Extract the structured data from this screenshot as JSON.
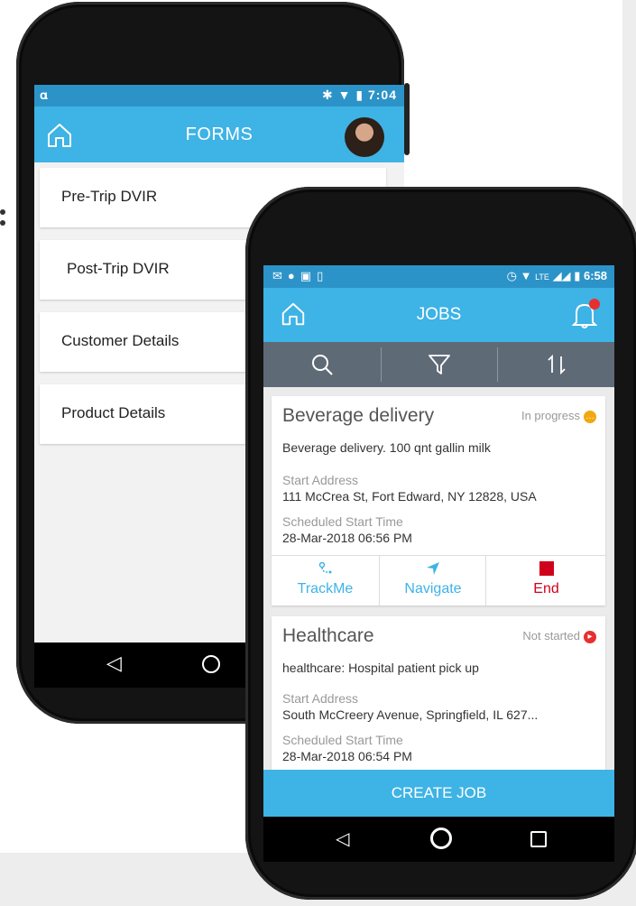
{
  "colors": {
    "appbar": "#3eb3e5",
    "statusbar": "#2c93c8",
    "toolbar": "#5e6a76",
    "in_progress": "#f2a812",
    "not_started": "#e63030",
    "end": "#d0021b"
  },
  "forms_screen": {
    "status_time": "7:04",
    "title": "FORMS",
    "items": [
      {
        "label": "Pre-Trip DVIR"
      },
      {
        "label": "Post-Trip DVIR"
      },
      {
        "label": "Customer Details"
      },
      {
        "label": "Product Details"
      }
    ]
  },
  "jobs_screen": {
    "status_time": "6:58",
    "status_network": "LTE",
    "title": "JOBS",
    "toolbar": {
      "search_icon": "search-icon",
      "filter_icon": "filter-icon",
      "sort_icon": "sort-icon"
    },
    "jobs": [
      {
        "title": "Beverage delivery",
        "status": "In progress",
        "description": "Beverage delivery. 100 qnt gallin milk",
        "address_label": "Start Address",
        "address": "111 McCrea St, Fort Edward, NY 12828, USA",
        "time_label": "Scheduled Start Time",
        "time": "28-Mar-2018 06:56 PM",
        "actions": {
          "trackme": "TrackMe",
          "navigate": "Navigate",
          "end": "End"
        }
      },
      {
        "title": "Healthcare",
        "status": "Not started",
        "description": "healthcare: Hospital patient pick up",
        "address_label": "Start Address",
        "address": "South McCreery Avenue, Springfield, IL 627...",
        "time_label": "Scheduled Start Time",
        "time": "28-Mar-2018 06:54 PM"
      }
    ],
    "create_button": "CREATE JOB"
  }
}
